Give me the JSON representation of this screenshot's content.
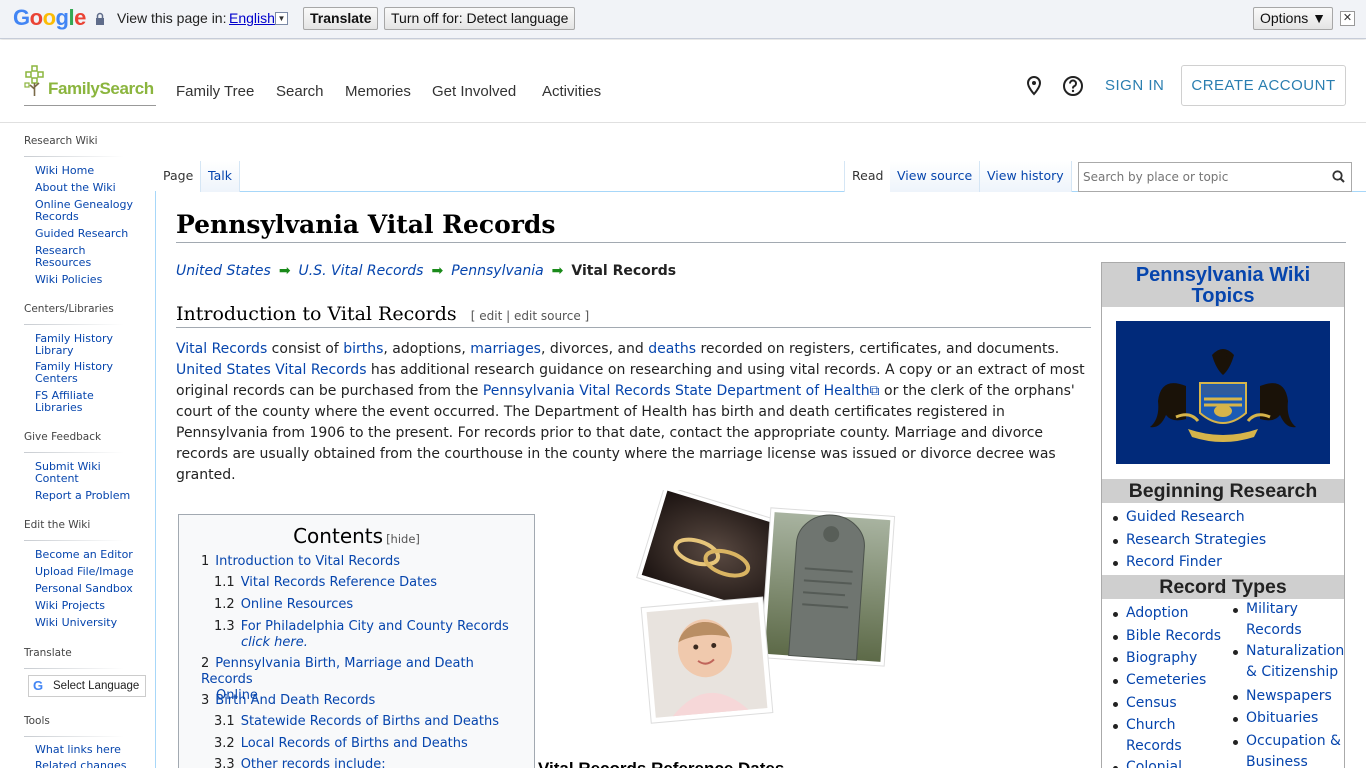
{
  "translate_bar": {
    "logo_letters": [
      "G",
      "o",
      "o",
      "g",
      "l",
      "e"
    ],
    "logo_colors": [
      "#4285f4",
      "#ea4335",
      "#fbbc05",
      "#4285f4",
      "#34a853",
      "#ea4335"
    ],
    "view_label": "View this page in:",
    "language": "English",
    "translate_button": "Translate",
    "turn_off_button": "Turn off for: Detect language",
    "options_button": "Options ▼",
    "close": "✕"
  },
  "header": {
    "logo": "FamilySearch",
    "nav": [
      "Family Tree",
      "Search",
      "Memories",
      "Get Involved",
      "Activities"
    ],
    "sign_in": "SIGN IN",
    "create_account": "CREATE ACCOUNT"
  },
  "sidebar": {
    "sections": [
      {
        "title": "Research Wiki",
        "items": [
          "Wiki Home",
          "About the Wiki",
          "Online Genealogy Records",
          "Guided Research",
          "Research Resources",
          "Wiki Policies"
        ]
      },
      {
        "title": "Centers/Libraries",
        "items": [
          "Family History Library",
          "Family History Centers",
          "FS Affiliate Libraries"
        ]
      },
      {
        "title": "Give Feedback",
        "items": [
          "Submit Wiki Content",
          "Report a Problem"
        ]
      },
      {
        "title": "Edit the Wiki",
        "items": [
          "Become an Editor",
          "Upload File/Image",
          "Personal Sandbox",
          "Wiki Projects",
          "Wiki University"
        ]
      },
      {
        "title": "Translate",
        "items": []
      },
      {
        "title": "Tools",
        "items": [
          "What links here",
          "Related changes"
        ]
      }
    ],
    "select_language": "Select Language"
  },
  "tabs": {
    "left": [
      "Page",
      "Talk"
    ],
    "right": [
      "Read",
      "View source",
      "View history"
    ],
    "search_placeholder": "Search by place or topic"
  },
  "page": {
    "title": "Pennsylvania Vital Records",
    "breadcrumbs": [
      "United States",
      "U.S. Vital Records",
      "Pennsylvania"
    ],
    "breadcrumb_current": "Vital Records",
    "section_title": "Introduction to Vital Records",
    "section_edit": "[ edit | edit source ]",
    "intro": [
      {
        "t": "Vital Records",
        "link": true
      },
      {
        "t": " consist of ",
        "link": false
      },
      {
        "t": "births",
        "link": true
      },
      {
        "t": ", adoptions, ",
        "link": false
      },
      {
        "t": "marriages",
        "link": true
      },
      {
        "t": ", divorces, and ",
        "link": false
      },
      {
        "t": "deaths",
        "link": true
      },
      {
        "t": " recorded on registers, certificates, and documents. ",
        "link": false
      },
      {
        "t": "United States Vital Records",
        "link": true
      },
      {
        "t": " has additional research guidance on researching and using vital records. A copy or an extract of most original records can be purchased from the ",
        "link": false
      },
      {
        "t": "Pennsylvania Vital Records State Department of Health⧉",
        "link": true
      },
      {
        "t": " or the clerk of the orphans' court of the county where the event occurred. The Department of Health has birth and death certificates registered in Pennsylvania from 1906 to the present. For records prior to that date, contact the appropriate county. Marriage and divorce records are usually obtained from the courthouse in the county where the marriage license was issued or divorce decree was granted.",
        "link": false
      }
    ],
    "next_heading": "Vital Records Reference Dates"
  },
  "toc": {
    "title": "Contents",
    "hide": "[hide]",
    "items": [
      {
        "num": "1",
        "label": "Introduction to Vital Records",
        "level": 1
      },
      {
        "num": "1.1",
        "label": "Vital Records Reference Dates",
        "level": 2
      },
      {
        "num": "1.2",
        "label": "Online Resources",
        "level": 2
      },
      {
        "num": "1.3",
        "label": "For Philadelphia City and County Records",
        "label2": "click here.",
        "level": 2
      },
      {
        "num": "2",
        "label": "Pennsylvania Birth, Marriage and Death Records",
        "label2": "Online",
        "level": 1
      },
      {
        "num": "3",
        "label": "Birth And Death Records",
        "level": 1
      },
      {
        "num": "3.1",
        "label": "Statewide Records of Births and Deaths",
        "level": 2
      },
      {
        "num": "3.2",
        "label": "Local Records of Births and Deaths",
        "level": 2
      },
      {
        "num": "3.3",
        "label": "Other records include:",
        "level": 2
      }
    ]
  },
  "infobox": {
    "title": "Pennsylvania Wiki Topics",
    "beginning_title": "Beginning Research",
    "beginning_links": [
      "Guided Research",
      "Research Strategies",
      "Record Finder"
    ],
    "record_types_title": "Record Types",
    "record_types_col1": [
      "Adoption",
      "Bible Records",
      "Biography",
      "Cemeteries",
      "Census",
      "Church Records",
      "Colonial"
    ],
    "record_types_col2": [
      "Military Records",
      "Naturalization & Citizenship",
      "Newspapers",
      "Obituaries",
      "Occupation & Business"
    ]
  }
}
